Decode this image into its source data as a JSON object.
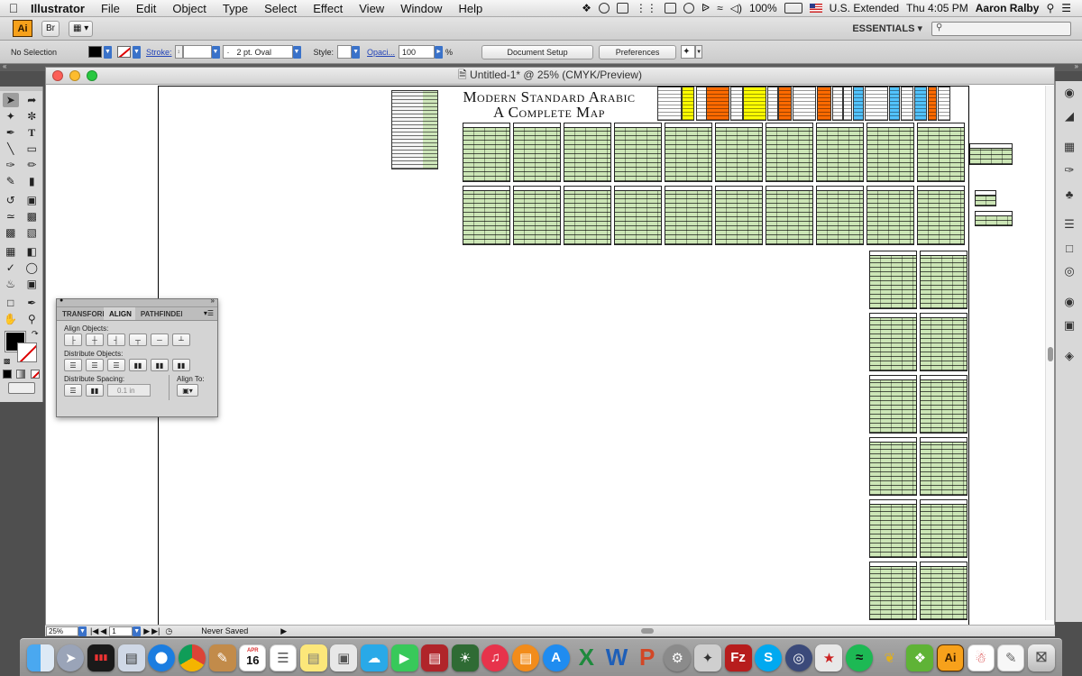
{
  "menubar": {
    "app_name": "Illustrator",
    "items": [
      "File",
      "Edit",
      "Object",
      "Type",
      "Select",
      "Effect",
      "View",
      "Window",
      "Help"
    ],
    "battery": "100%",
    "input_source": "U.S. Extended",
    "clock": "Thu 4:05 PM",
    "user": "Aaron Ralby"
  },
  "appbar": {
    "logo": "Ai",
    "bridge_label": "Br",
    "workspace": "ESSENTIALS ▾"
  },
  "controlbar": {
    "selection": "No Selection",
    "stroke_label": "Stroke:",
    "brush": "2 pt. Oval",
    "style_label": "Style:",
    "opacity_label": "Opaci...",
    "opacity_value": "100",
    "opacity_unit": "%",
    "document_setup": "Document Setup",
    "preferences": "Preferences"
  },
  "document": {
    "title": "Untitled-1* @ 25% (CMYK/Preview)"
  },
  "poster": {
    "title_line1": "Modern Standard Arabic",
    "title_line2": "A Complete Map"
  },
  "align_panel": {
    "tabs": [
      "TRANSFORM",
      "ALIGN",
      "PATHFINDER"
    ],
    "active_tab": "ALIGN",
    "align_objects_label": "Align Objects:",
    "distribute_objects_label": "Distribute Objects:",
    "distribute_spacing_label": "Distribute Spacing:",
    "align_to_label": "Align To:",
    "spacing_value": "0.1 in"
  },
  "statusbar": {
    "zoom": "25%",
    "artboard": "1",
    "status": "Never Saved"
  },
  "colors": {
    "table_green": "#cce6b6",
    "highlight_yellow": "#ffff00",
    "highlight_orange": "#ff6a00",
    "highlight_blue": "#52c3ff",
    "ai_orange": "#f7a11b"
  },
  "dock": {
    "calendar_month": "APR",
    "calendar_day": "16",
    "app_icons": [
      "finder",
      "launchpad",
      "activity-monitor",
      "preview",
      "safari",
      "chrome",
      "textwrangler",
      "calendar",
      "reminders",
      "stickies",
      "photo",
      "maps",
      "facetime",
      "photo-booth",
      "photos",
      "itunes",
      "ibooks",
      "app-store",
      "excel",
      "word",
      "powerpoint",
      "system-preferences",
      "filezilla",
      "dark-app",
      "skype",
      "network",
      "bookmark",
      "spotify",
      "genie",
      "evernote",
      "illustrator",
      "acrobat",
      "textedit",
      "trash"
    ]
  }
}
